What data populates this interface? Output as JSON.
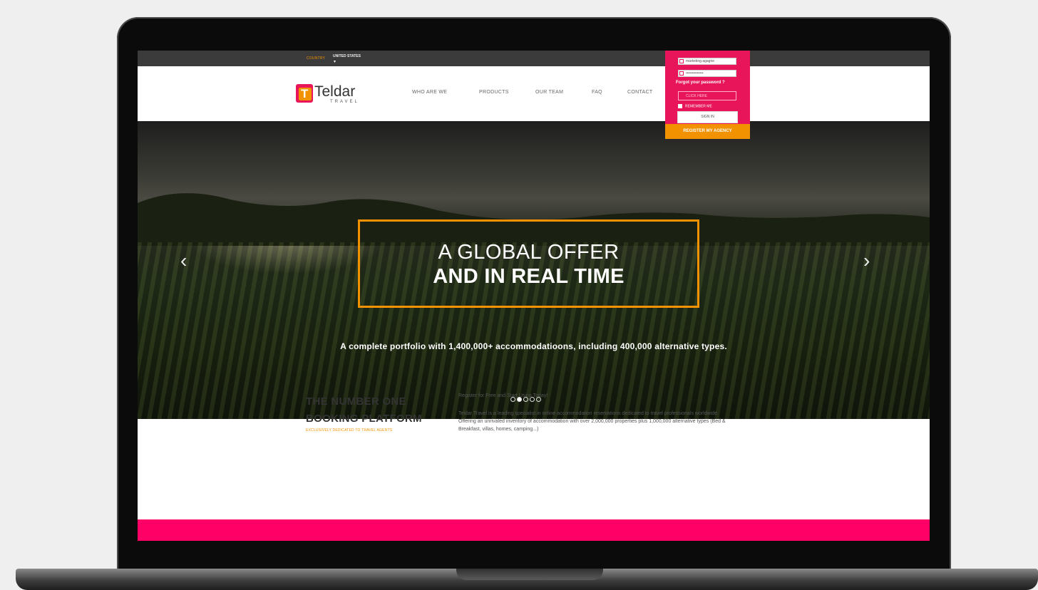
{
  "topbar": {
    "country_label": "COUNTRY",
    "country_value": "UNITED STATES",
    "caret": "▾"
  },
  "logo": {
    "mark": "T",
    "brand": "Teldar",
    "sub": "TRAVEL"
  },
  "nav": {
    "items": [
      {
        "label": "WHO ARE WE"
      },
      {
        "label": "PRODUCTS"
      },
      {
        "label": "OUR TEAM"
      },
      {
        "label": "FAQ"
      },
      {
        "label": "CONTACT"
      }
    ]
  },
  "login": {
    "username_value": "marketing.agagne",
    "password_value": "••••••••••••••",
    "forgot_label": "Forgot your password ?",
    "captcha_placeholder": "CLICK HERE",
    "remember_label": "REMEMBER ME",
    "signin_label": "SIGN IN",
    "register_label": "REGISTER MY AGENCY"
  },
  "hero": {
    "headline_line1": "A GLOBAL OFFER",
    "headline_line2": "AND IN REAL TIME",
    "subtitle": "A complete portfolio with 1,400,000+ accommodatioons, including 400,000 alternative types.",
    "prev_arrow": "‹",
    "next_arrow": "›",
    "slide_count": 5,
    "active_slide": 2
  },
  "intro": {
    "title_line1": "THE NUMBER ONE",
    "title_line2": "BOOKING PLATFORM",
    "tagline": "EXCLUSIVELY DEDICATED TO TRAVEL AGENTS",
    "p1": "Register for Free and Start Using Today!",
    "p2": "Teldar Travel is a leading specialist in online accommodation reservations dedicated to travel professionals worldwide.",
    "p3": "Offering an unrivaled inventory of accommodation with over 2,000,000 properties plus 1,000,000 alternative types (Bed & Breakfast, villas, homes, camping...)"
  },
  "colors": {
    "brand_pink": "#ff0066",
    "brand_magenta": "#e8155a",
    "brand_orange": "#f39200"
  }
}
